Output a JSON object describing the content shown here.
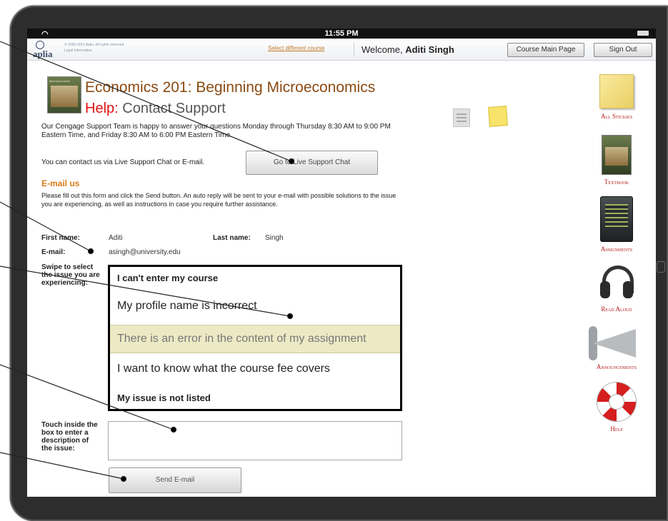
{
  "statusbar": {
    "time": "11:55 PM"
  },
  "header": {
    "logo_text": "aplia",
    "copyright_line1": "© 2000-2011 Aplia. All rights reserved.",
    "copyright_line2": "Legal Information",
    "select_course_link": "Select different course",
    "welcome_prefix": "Welcome,",
    "user_name": "Aditi Singh",
    "course_main_page_label": "Course Main Page",
    "sign_out_label": "Sign Out"
  },
  "page": {
    "book_cover_title": "Microeconomics",
    "course_title": "Economics 201: Beginning Microeconomics",
    "help_word": "Help:",
    "help_subtitle": "Contact Support",
    "intro_text": "Our Cengage Support Team is happy to answer your questions Monday through Thursday 8:30 AM to 9:00 PM Eastern Time, and Friday 8:30 AM to 6:00 PM Eastern Time.",
    "contact_text": "You can contact us via Live Support Chat or E-mail.",
    "live_chat_button": "Go to Live Support Chat",
    "email_heading": "E-mail us",
    "instructions": "Please fill out this form and click the Send button.  An auto reply will be sent to your e-mail with possible solutions to the issue you are experiencing, as well as instructions in case you require further assistance."
  },
  "form": {
    "first_name_label": "First name:",
    "first_name_value": "Aditi",
    "last_name_label": "Last name:",
    "last_name_value": "Singh",
    "email_label": "E-mail:",
    "email_value": "asingh@university.edu",
    "swipe_label": "Swipe to select the issue you are experiencing:",
    "issues": [
      "I can't enter my course",
      "My profile name is incorrect",
      "There is an error in the content of my assignment",
      "I want to know what the course fee covers",
      "My issue is not listed"
    ],
    "selected_issue_index": 2,
    "touch_label": "Touch inside the box to enter a description of the issue:",
    "description_value": "",
    "send_button": "Send E-mail"
  },
  "sidebar": {
    "items": [
      {
        "label": "All Stickies",
        "icon": "sticky-note-icon"
      },
      {
        "label": "Textbook",
        "icon": "textbook-icon"
      },
      {
        "label": "Assignments",
        "icon": "assignments-icon"
      },
      {
        "label": "Read Aloud",
        "icon": "headphones-icon"
      },
      {
        "label": "Announcements",
        "icon": "megaphone-icon"
      },
      {
        "label": "Help",
        "icon": "life-ring-icon"
      }
    ]
  },
  "colors": {
    "course_title": "#8a4a12",
    "help_red": "#e11212",
    "email_heading_orange": "#d97a17",
    "sidebar_label_red": "#b21a1a",
    "picker_selected_bg": "#ede9c4"
  }
}
